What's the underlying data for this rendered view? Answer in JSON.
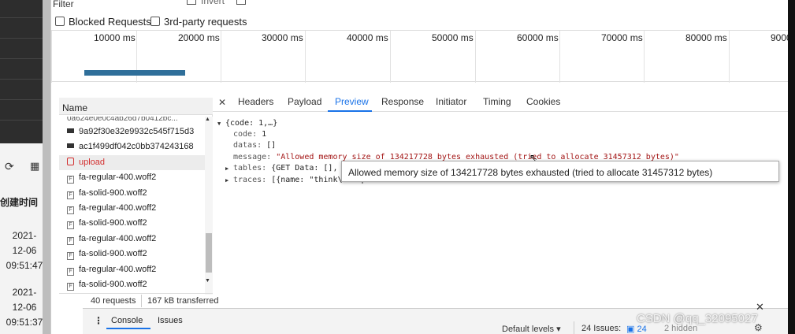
{
  "host": {
    "column_header": "创建时间",
    "dates": [
      {
        "date": "2021-",
        "date2": "12-06",
        "time": "09:51:47"
      },
      {
        "date": "2021-",
        "date2": "12-06",
        "time": "09:51:37"
      }
    ],
    "icons": [
      "refresh-icon",
      "grid-icon"
    ]
  },
  "filter": {
    "label": "Filter",
    "invert_label": "Invert",
    "blocked_requests_label": "Blocked Requests",
    "third_party_label": "3rd-party requests"
  },
  "overview": {
    "ticks": [
      "10000 ms",
      "20000 ms",
      "30000 ms",
      "40000 ms",
      "50000 ms",
      "60000 ms",
      "70000 ms",
      "80000 ms",
      "9000"
    ]
  },
  "request_list": {
    "header": "Name",
    "cut_item": "0a624e0e0c4ab26d7b0412bc...",
    "items": [
      {
        "name": "9a92f30e32e9932c545f715d3",
        "icon": "dark-file-icon",
        "selected": false
      },
      {
        "name": "ac1f499df042c0bb374243168",
        "icon": "dark-file-icon",
        "selected": false
      },
      {
        "name": "upload",
        "icon": "error-file-icon",
        "selected": true
      },
      {
        "name": "fa-regular-400.woff2",
        "icon": "font-file-icon",
        "selected": false
      },
      {
        "name": "fa-solid-900.woff2",
        "icon": "font-file-icon",
        "selected": false
      },
      {
        "name": "fa-regular-400.woff2",
        "icon": "font-file-icon",
        "selected": false
      },
      {
        "name": "fa-solid-900.woff2",
        "icon": "font-file-icon",
        "selected": false
      },
      {
        "name": "fa-regular-400.woff2",
        "icon": "font-file-icon",
        "selected": false
      },
      {
        "name": "fa-solid-900.woff2",
        "icon": "font-file-icon",
        "selected": false
      },
      {
        "name": "fa-regular-400.woff2",
        "icon": "font-file-icon",
        "selected": false
      },
      {
        "name": "fa-solid-900.woff2",
        "icon": "font-file-icon",
        "selected": false
      }
    ],
    "status_requests": "40 requests",
    "status_transferred": "167 kB transferred"
  },
  "detail": {
    "tabs": [
      "Headers",
      "Payload",
      "Preview",
      "Response",
      "Initiator",
      "Timing",
      "Cookies"
    ],
    "active_tab": "Preview",
    "preview": {
      "root": "{code: 1,…}",
      "code_key": "code:",
      "code_val": "1",
      "datas_key": "datas:",
      "datas_val": "[]",
      "message_key": "message:",
      "message_val": "\"Allowed memory size of 134217728 bytes exhausted (tried to allocate 31457312 bytes)\"",
      "tables_key": "tables:",
      "tables_val": "{GET Data: [], POST Da",
      "traces_key": "traces:",
      "traces_val": "[{name: \"think\\excepti"
    },
    "tooltip": "Allowed memory size of 134217728 bytes exhausted (tried to allocate 31457312 bytes)"
  },
  "drawer": {
    "console_tab": "Console",
    "issues_tab": "Issues",
    "default_levels": "Default levels ▾",
    "issues_count": "24 Issues:",
    "issues_badge": "24",
    "hidden": "2 hidden"
  },
  "watermark": "CSDN @qq_32095027"
}
